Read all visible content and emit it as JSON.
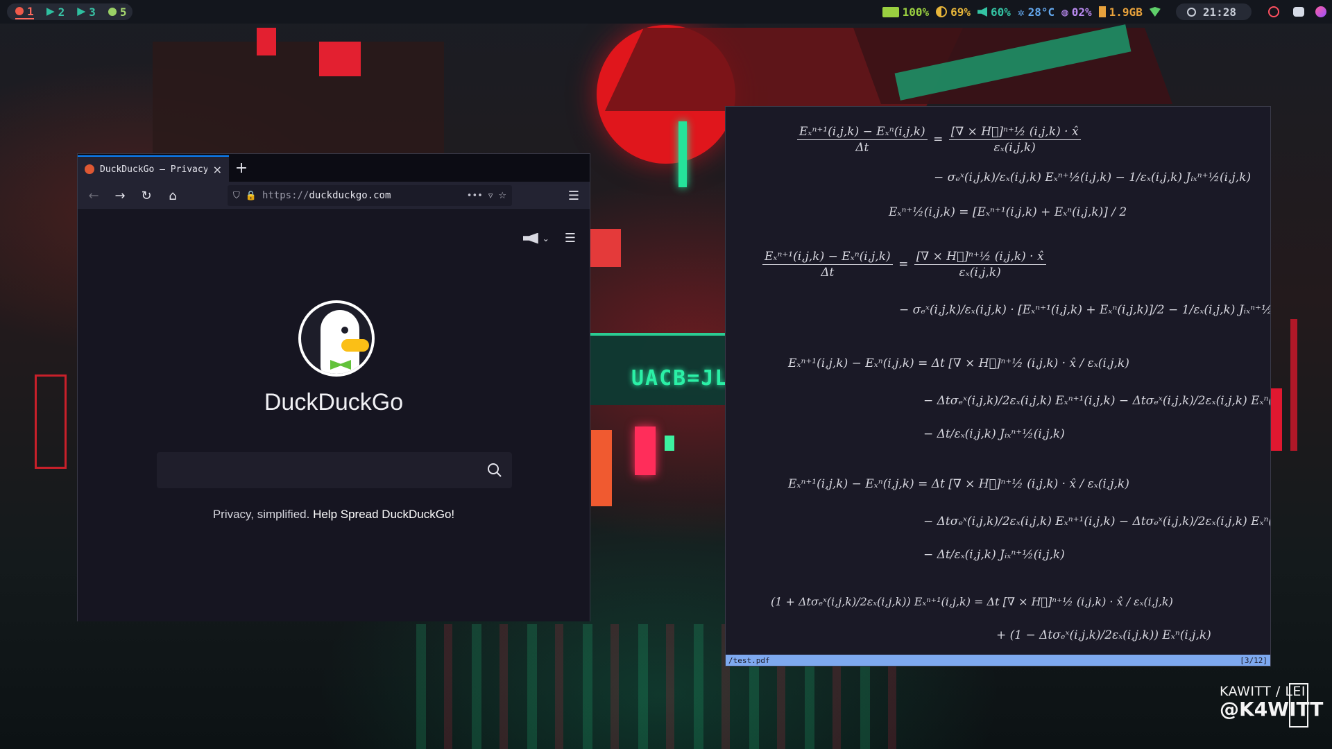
{
  "topbar": {
    "workspaces": [
      {
        "label": "1",
        "icon": "firefox-icon",
        "active": true
      },
      {
        "label": "2",
        "icon": "terminal-icon",
        "active": false
      },
      {
        "label": "3",
        "icon": "terminal-icon",
        "active": false
      },
      {
        "label": "5",
        "icon": "spotify-icon",
        "active": false
      }
    ],
    "status": {
      "battery": "100%",
      "brightness": "69%",
      "volume": "60%",
      "temperature": "28°C",
      "cpu": "02%",
      "memory": "1.9GB"
    },
    "clock": "21:28"
  },
  "browser": {
    "tab_title": "DuckDuckGo — Privacy",
    "tab_close": "×",
    "new_tab": "+",
    "url_prefix": "https://",
    "url_host": "duckduckgo.com",
    "page": {
      "brand": "DuckDuckGo",
      "search_placeholder": "",
      "tagline_plain": "Privacy, simplified.",
      "tagline_link": "Help Spread DuckDuckGo!"
    }
  },
  "pdf": {
    "filename": "/test.pdf",
    "page_indicator": "[3/12]",
    "equations": [
      {
        "lhs": "Eₓⁿ⁺¹(i,j,k) − Eₓⁿ(i,j,k)",
        "lhs_den": "Δt",
        "rhs_num": "[∇ × H⃗]ⁿ⁺½ (i,j,k) · x̂",
        "rhs_den": "εₓ(i,j,k)"
      },
      {
        "text": "− σₑˣ(i,j,k)/εₓ(i,j,k) Eₓⁿ⁺½(i,j,k) − 1/εₓ(i,j,k) Jᵢₓⁿ⁺½(i,j,k)"
      },
      {
        "text": "Eₓⁿ⁺½(i,j,k) = [Eₓⁿ⁺¹(i,j,k) + Eₓⁿ(i,j,k)] / 2"
      },
      {
        "lhs": "Eₓⁿ⁺¹(i,j,k) − Eₓⁿ(i,j,k)",
        "lhs_den": "Δt",
        "rhs_num": "[∇ × H⃗]ⁿ⁺½ (i,j,k) · x̂",
        "rhs_den": "εₓ(i,j,k)"
      },
      {
        "text": "− σₑˣ(i,j,k)/εₓ(i,j,k) · [Eₓⁿ⁺¹(i,j,k) + Eₓⁿ(i,j,k)]/2 − 1/εₓ(i,j,k) Jᵢₓⁿ⁺½(i,j,k)"
      },
      {
        "text": "Eₓⁿ⁺¹(i,j,k) − Eₓⁿ(i,j,k) = Δt [∇ × H⃗]ⁿ⁺½ (i,j,k) · x̂ / εₓ(i,j,k)"
      },
      {
        "text": "− Δtσₑˣ(i,j,k)/2εₓ(i,j,k) Eₓⁿ⁺¹(i,j,k) − Δtσₑˣ(i,j,k)/2εₓ(i,j,k) Eₓⁿ(i,j,k)"
      },
      {
        "text": "− Δt/εₓ(i,j,k) Jᵢₓⁿ⁺½(i,j,k)"
      },
      {
        "text": "Eₓⁿ⁺¹(i,j,k) − Eₓⁿ(i,j,k) = Δt [∇ × H⃗]ⁿ⁺½ (i,j,k) · x̂ / εₓ(i,j,k)"
      },
      {
        "text": "− Δtσₑˣ(i,j,k)/2εₓ(i,j,k) Eₓⁿ⁺¹(i,j,k) − Δtσₑˣ(i,j,k)/2εₓ(i,j,k) Eₓⁿ(i,j,k)"
      },
      {
        "text": "− Δt/εₓ(i,j,k) Jᵢₓⁿ⁺½(i,j,k)"
      },
      {
        "text": "(1 + Δtσₑˣ(i,j,k)/2εₓ(i,j,k)) Eₓⁿ⁺¹(i,j,k) = Δt [∇ × H⃗]ⁿ⁺½ (i,j,k) · x̂ / εₓ(i,j,k)"
      },
      {
        "text": "+ (1 − Δtσₑˣ(i,j,k)/2εₓ(i,j,k)) Eₓⁿ(i,j,k)"
      }
    ]
  },
  "wallpaper": {
    "sign_text": "UACB=JL",
    "credit_line1": "KAWITT / LEI",
    "credit_line2": "@K4WITT"
  },
  "colors": {
    "accent_blue": "#0a84ff",
    "statusline": "#7ea9ef",
    "ws_active": "#ff6a5e",
    "ws_terminal": "#39c4a7",
    "ws_spotify": "#a6d86f",
    "battery": "#9ad040",
    "brightness": "#e8b63a",
    "volume": "#34c4a4",
    "temperature": "#64a8ee",
    "cpu": "#b98af0",
    "memory": "#e8a23c"
  }
}
